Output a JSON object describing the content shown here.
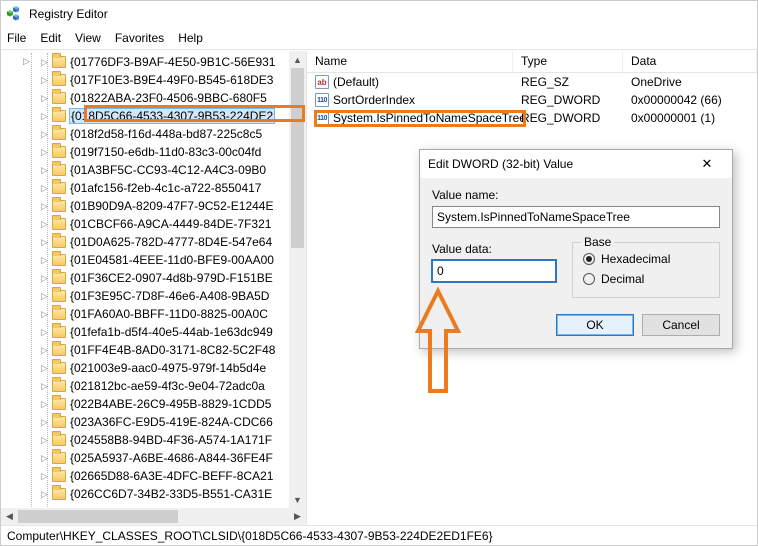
{
  "window": {
    "title": "Registry Editor"
  },
  "menu": {
    "file": "File",
    "edit": "Edit",
    "view": "View",
    "favorites": "Favorites",
    "help": "Help"
  },
  "tree": {
    "items": [
      "{01776DF3-B9AF-4E50-9B1C-56E931",
      "{017F10E3-B9E4-49F0-B545-618DE3",
      "{01822ABA-23F0-4506-9BBC-680F5",
      "{018D5C66-4533-4307-9B53-224DE2",
      "{018f2d58-f16d-448a-bd87-225c8c5",
      "{019f7150-e6db-11d0-83c3-00c04fd",
      "{01A3BF5C-CC93-4C12-A4C3-09B0",
      "{01afc156-f2eb-4c1c-a722-8550417",
      "{01B90D9A-8209-47F7-9C52-E1244E",
      "{01CBCF66-A9CA-4449-84DE-7F321",
      "{01D0A625-782D-4777-8D4E-547e64",
      "{01E04581-4EEE-11d0-BFE9-00AA00",
      "{01F36CE2-0907-4d8b-979D-F151BE",
      "{01F3E95C-7D8F-46e6-A408-9BA5D",
      "{01FA60A0-BBFF-11D0-8825-00A0C",
      "{01fefa1b-d5f4-40e5-44ab-1e63dc949",
      "{01FF4E4B-8AD0-3171-8C82-5C2F48",
      "{021003e9-aac0-4975-979f-14b5d4e",
      "{021812bc-ae59-4f3c-9e04-72adc0a",
      "{022B4ABE-26C9-495B-8829-1CDD5",
      "{023A36FC-E9D5-419E-824A-CDC66",
      "{024558B8-94BD-4F36-A574-1A171F",
      "{025A5937-A6BE-4686-A844-36FE4F",
      "{02665D88-6A3E-4DFC-BEFF-8CA21",
      "{026CC6D7-34B2-33D5-B551-CA31E"
    ],
    "selectedIndex": 3
  },
  "list": {
    "columns": {
      "name": "Name",
      "type": "Type",
      "data": "Data"
    },
    "rows": [
      {
        "name": "(Default)",
        "type": "REG_SZ",
        "data": "OneDrive",
        "icon": "sz"
      },
      {
        "name": "SortOrderIndex",
        "type": "REG_DWORD",
        "data": "0x00000042 (66)",
        "icon": "dw"
      },
      {
        "name": "System.IsPinnedToNameSpaceTree",
        "type": "REG_DWORD",
        "data": "0x00000001 (1)",
        "icon": "dw"
      }
    ]
  },
  "dialog": {
    "title": "Edit DWORD (32-bit) Value",
    "valueNameLabel": "Value name:",
    "valueName": "System.IsPinnedToNameSpaceTree",
    "valueDataLabel": "Value data:",
    "valueData": "0",
    "baseLabel": "Base",
    "hexLabel": "Hexadecimal",
    "decLabel": "Decimal",
    "okLabel": "OK",
    "cancelLabel": "Cancel"
  },
  "statusbar": {
    "path": "Computer\\HKEY_CLASSES_ROOT\\CLSID\\{018D5C66-4533-4307-9B53-224DE2ED1FE6}"
  },
  "colors": {
    "annotation": "#ec7a1e",
    "selection": "#cde8ff",
    "primary": "#2e76c3"
  }
}
